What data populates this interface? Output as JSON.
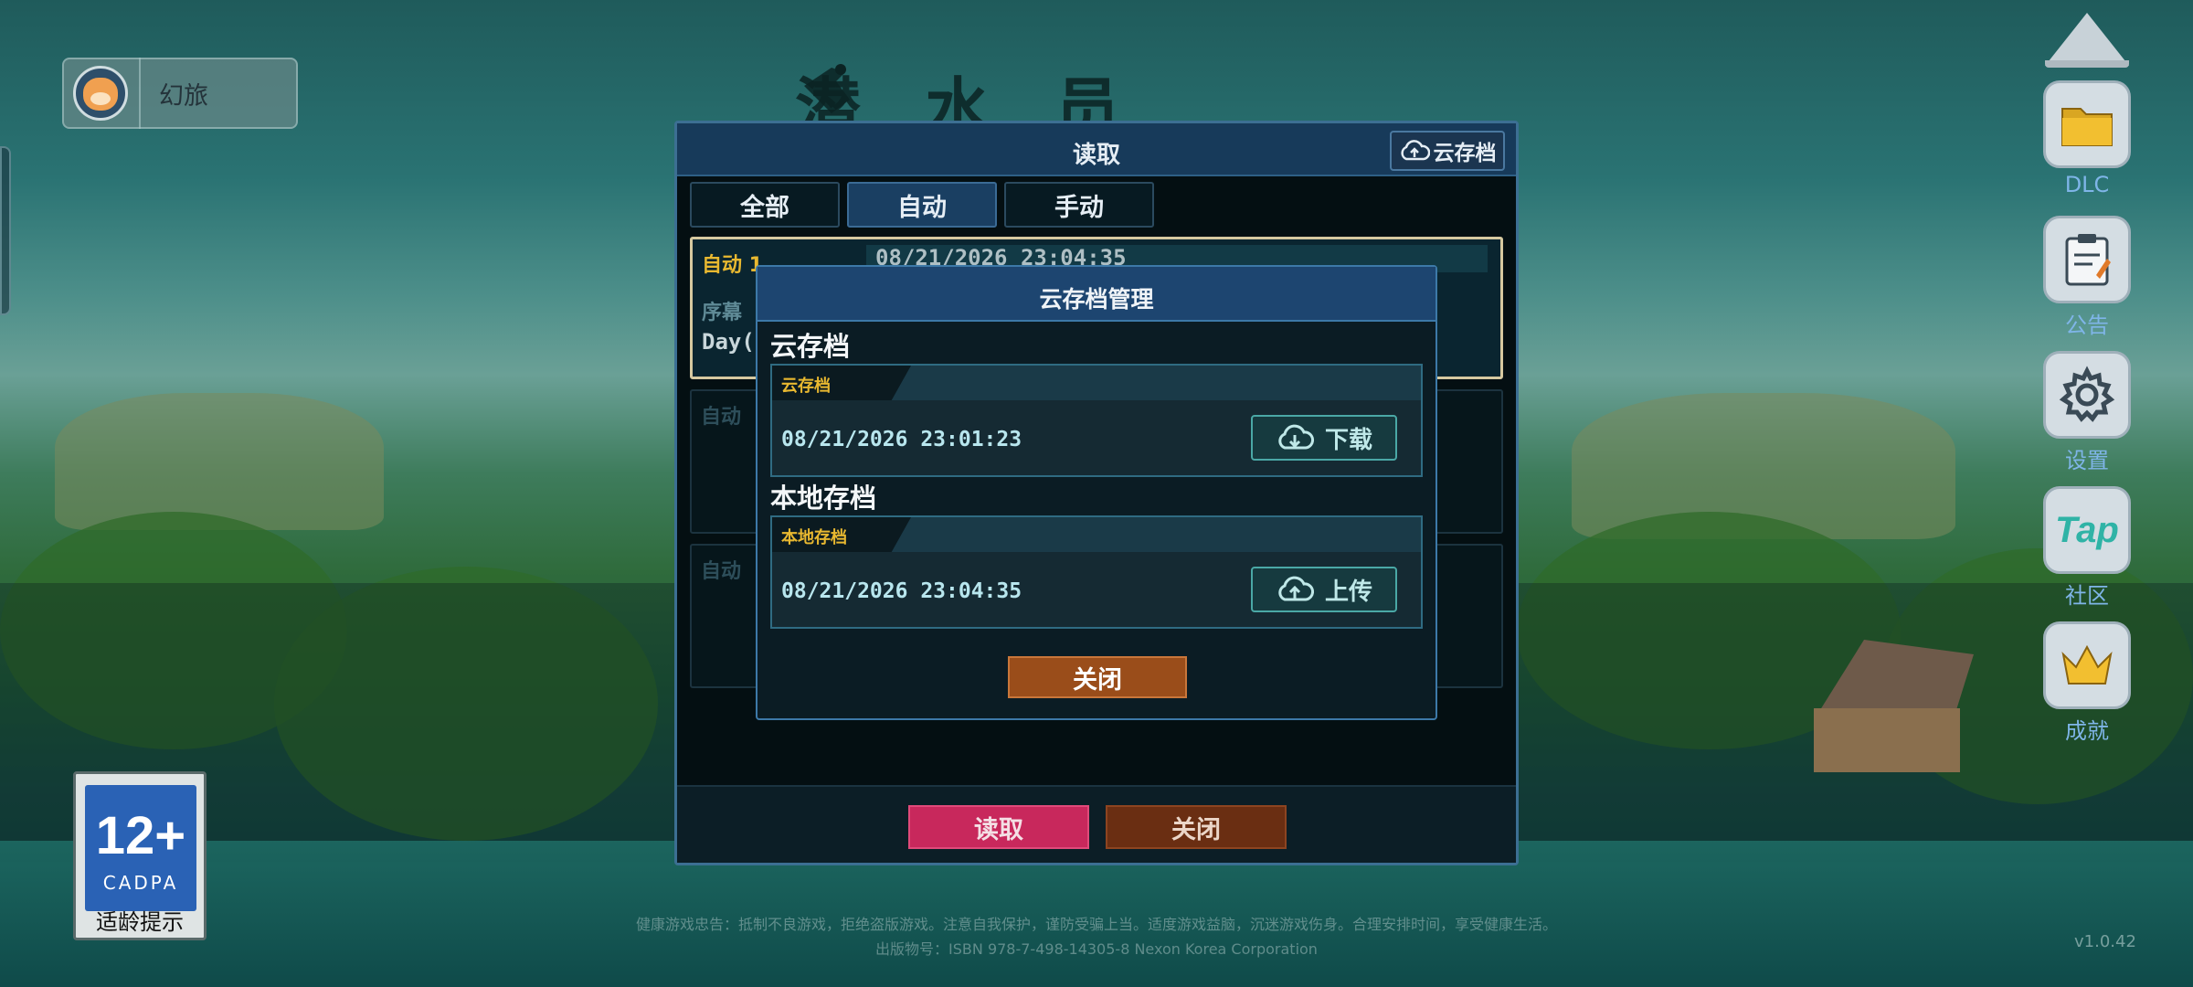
{
  "game": {
    "logo_title": "潜水员",
    "version": "v1.0.42"
  },
  "user": {
    "name": "幻旅"
  },
  "right_menu": [
    {
      "label": "DLC",
      "icon": "folder-icon"
    },
    {
      "label": "公告",
      "icon": "clipboard-icon"
    },
    {
      "label": "设置",
      "icon": "gear-icon"
    },
    {
      "label": "社区",
      "icon": "tap-logo-icon",
      "logo_text": "Tap"
    },
    {
      "label": "成就",
      "icon": "crown-icon"
    }
  ],
  "age_rating": {
    "age": "12+",
    "org": "CADPA",
    "hint": "适龄提示"
  },
  "footer": {
    "line1": "健康游戏忠告：抵制不良游戏，拒绝盗版游戏。注意自我保护，谨防受骗上当。适度游戏益脑，沉迷游戏伤身。合理安排时间，享受健康生活。",
    "line2": "出版物号：ISBN 978-7-498-14305-8   Nexon Korea Corporation"
  },
  "load_window": {
    "title": "读取",
    "cloud_button": "云存档",
    "tabs": [
      {
        "label": "全部",
        "active": false
      },
      {
        "label": "自动",
        "active": true
      },
      {
        "label": "手动",
        "active": false
      }
    ],
    "slots": [
      {
        "label": "自动 1",
        "date": "08/21/2026 23:04:35",
        "chapter": "序幕",
        "day": "Day(",
        "selected": true
      },
      {
        "label": "自动",
        "selected": false
      },
      {
        "label": "自动",
        "selected": false
      }
    ],
    "read_button": "读取",
    "close_button": "关闭"
  },
  "cloud_dialog": {
    "title": "云存档管理",
    "cloud_section": {
      "heading": "云存档",
      "tag": "云存档",
      "timestamp": "08/21/2026 23:01:23",
      "action": "下载"
    },
    "local_section": {
      "heading": "本地存档",
      "tag": "本地存档",
      "timestamp": "08/21/2026 23:04:35",
      "action": "上传"
    },
    "close_button": "关闭"
  }
}
